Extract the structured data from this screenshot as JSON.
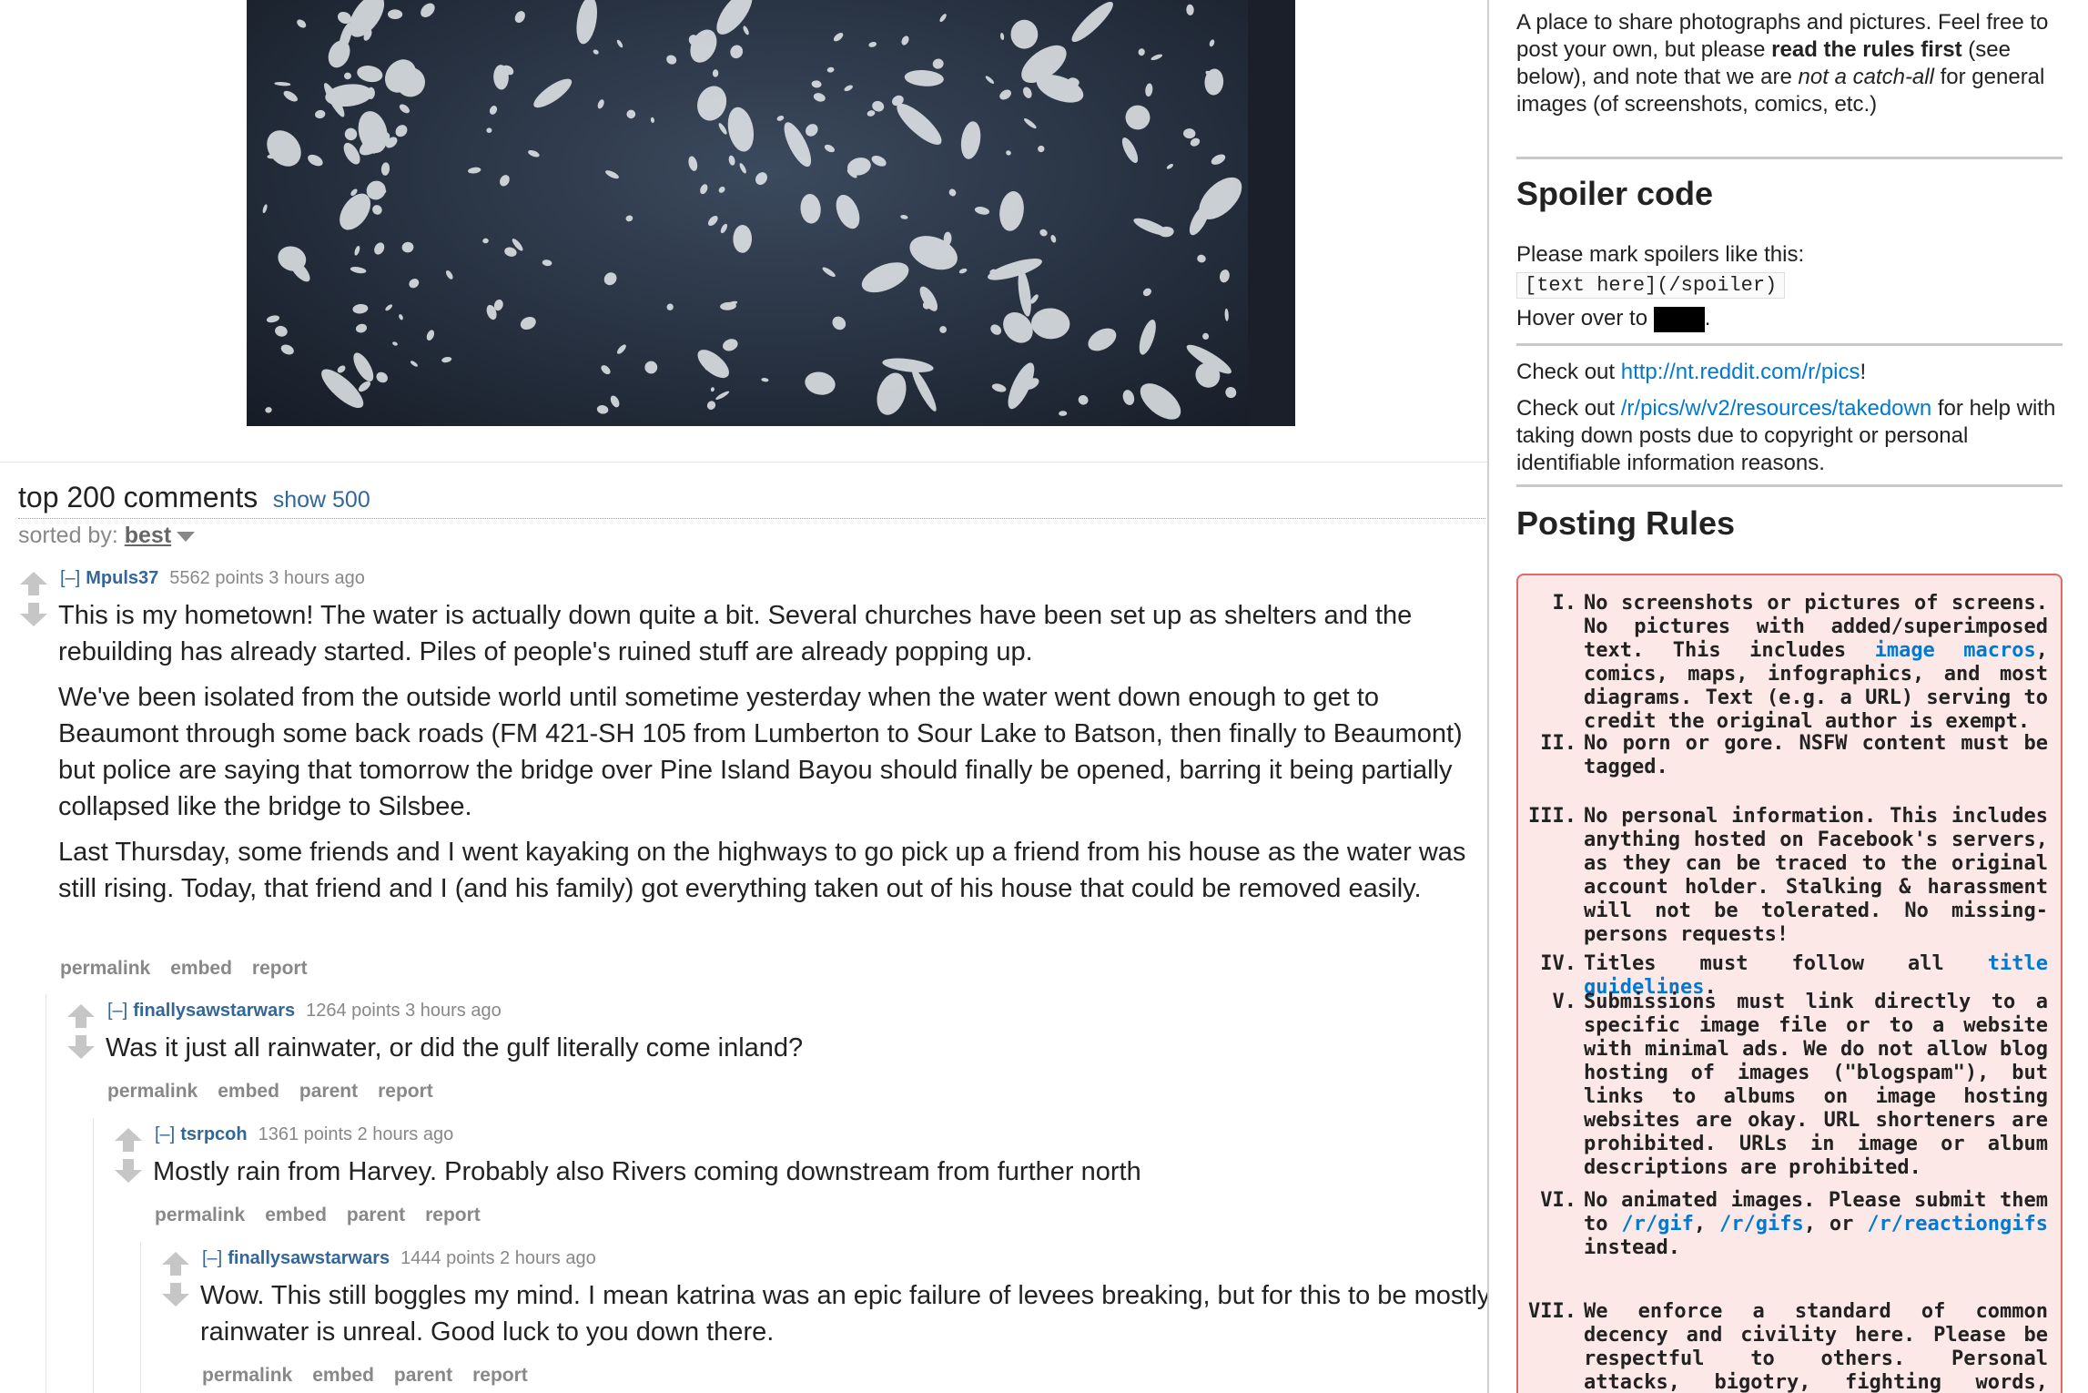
{
  "comments_header": {
    "title": "top 200 comments",
    "show_more": "show 500",
    "sorted_by_label": "sorted by:",
    "sorted_by_value": "best"
  },
  "comments": [
    {
      "collapse": "[–]",
      "author": "Mpuls37",
      "meta": "5562 points 3 hours ago",
      "paragraphs": [
        "This is my hometown! The water is actually down quite a bit. Several churches have been set up as shelters and the rebuilding has already started. Piles of people's ruined stuff are already popping up.",
        "We've been isolated from the outside world until sometime yesterday when the water went down enough to get to Beaumont through some back roads (FM 421-SH 105 from Lumberton to Sour Lake to Batson, then finally to Beaumont) but police are saying that tomorrow the bridge over Pine Island Bayou should finally be opened, barring it being partially collapsed like the bridge to Silsbee.",
        "Last Thursday, some friends and I went kayaking on the highways to go pick up a friend from his house as the water was still rising. Today, that friend and I (and his family) got everything taken out of his house that could be removed easily."
      ],
      "buttons": [
        "permalink",
        "embed",
        "report"
      ]
    },
    {
      "collapse": "[–]",
      "author": "finallysawstarwars",
      "meta": "1264 points 3 hours ago",
      "paragraphs": [
        "Was it just all rainwater, or did the gulf literally come inland?"
      ],
      "buttons": [
        "permalink",
        "embed",
        "parent",
        "report"
      ]
    },
    {
      "collapse": "[–]",
      "author": "tsrpcoh",
      "meta": "1361 points 2 hours ago",
      "paragraphs": [
        "Mostly rain from Harvey. Probably also Rivers coming downstream from further north"
      ],
      "buttons": [
        "permalink",
        "embed",
        "parent",
        "report"
      ]
    },
    {
      "collapse": "[–]",
      "author": "finallysawstarwars",
      "meta": "1444 points 2 hours ago",
      "paragraphs": [
        "Wow. This still boggles my mind. I mean katrina was an epic failure of levees breaking, but for this to be mostly rainwater is unreal. Good luck to you down there."
      ],
      "buttons": [
        "permalink",
        "embed",
        "parent",
        "report"
      ]
    }
  ],
  "sidebar": {
    "intro": {
      "t1": "A place to share photographs and pictures. Feel free to post your own, but please ",
      "b1": "read the rules first",
      "t2": " (see below), and note that we are ",
      "i1": "not a catch-all",
      "t3": " for general images (of screenshots, comics, etc.)"
    },
    "spoiler": {
      "heading": "Spoiler code",
      "line1": "Please mark spoilers like this:",
      "code": "[text here](/spoiler)",
      "hover_label": "Hover over to",
      "hover_end": "."
    },
    "checkout1": {
      "pre": "Check out ",
      "link": "http://nt.reddit.com/r/pics",
      "post": "!"
    },
    "checkout2": {
      "pre": "Check out ",
      "link": "/r/pics/w/v2/resources/takedown",
      "post": " for help with taking down posts due to copyright or personal identifiable information reasons."
    },
    "posting_rules_heading": "Posting Rules",
    "rules": [
      {
        "num": "I.",
        "parts": [
          {
            "t": "No screenshots or pictures of screens. No pictures with added/superimposed text. This includes "
          },
          {
            "l": "image macros"
          },
          {
            "t": ", comics, maps, infographics, and most diagrams. Text (e.g. a URL) serving to credit the original author is exempt."
          }
        ]
      },
      {
        "num": "II.",
        "parts": [
          {
            "t": "No porn or gore. NSFW content must be tagged."
          }
        ]
      },
      {
        "num": "III.",
        "parts": [
          {
            "t": "No personal information. This includes anything hosted on Facebook's servers, as they can be traced to the original account holder. Stalking & harassment will not be tolerated. No missing-persons requests!"
          }
        ]
      },
      {
        "num": "IV.",
        "parts": [
          {
            "t": "Titles must follow all "
          },
          {
            "l": "title guidelines"
          },
          {
            "t": "."
          }
        ]
      },
      {
        "num": "V.",
        "parts": [
          {
            "t": "Submissions must link directly to a specific image file or to a website with minimal ads. We do not allow blog hosting of images (\"blogspam\"), but links to albums on image hosting websites are okay. URL shorteners are prohibited. URLs in image or album descriptions are prohibited."
          }
        ]
      },
      {
        "num": "VI.",
        "parts": [
          {
            "t": "No animated images. Please submit them to "
          },
          {
            "l": "/r/gif"
          },
          {
            "t": ", "
          },
          {
            "l": "/r/gifs"
          },
          {
            "t": ", or "
          },
          {
            "l": "/r/reactiongifs"
          },
          {
            "t": " instead."
          }
        ]
      },
      {
        "num": "VII.",
        "parts": [
          {
            "t": "We enforce a standard of common decency and civility here. Please be respectful to others. Personal attacks, bigotry, fighting words, otherwise inappropriate behavior or content."
          }
        ]
      }
    ]
  },
  "colors": {
    "link": "#0079d3",
    "author": "#336699",
    "rules_bg": "#fde8e8",
    "rules_border": "#e06868"
  }
}
